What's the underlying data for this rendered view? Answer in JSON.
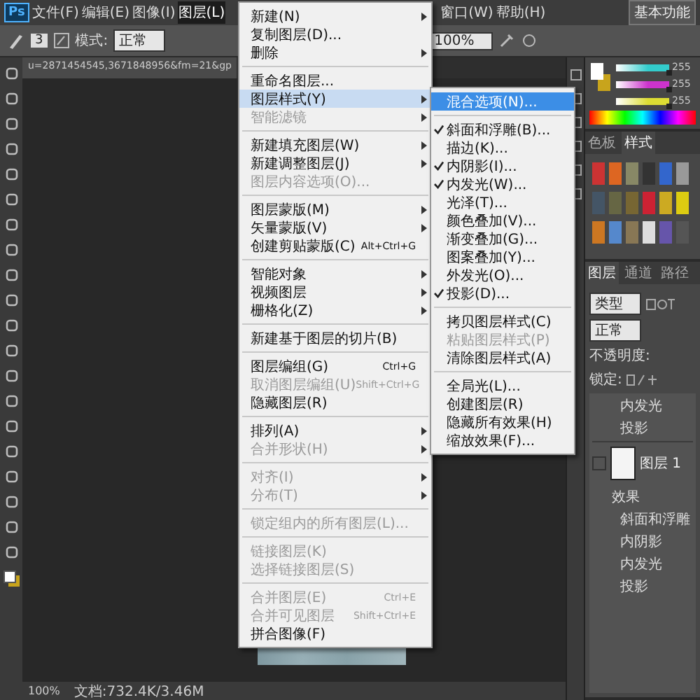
{
  "menu_bar": {
    "logo": "Ps",
    "items": [
      {
        "label": "文件(F)",
        "selected": false
      },
      {
        "label": "编辑(E)",
        "selected": false
      },
      {
        "label": "图像(I)",
        "selected": false
      },
      {
        "label": "图层(L)",
        "selected": true
      },
      {
        "label": "窗口(W)",
        "selected": false
      },
      {
        "label": "帮助(H)",
        "selected": false
      }
    ],
    "workspace": "基本功能"
  },
  "options_bar": {
    "brush_size": "3",
    "mode_label": "模式:",
    "mode": "正常",
    "flow": "100%"
  },
  "document_tab": {
    "title": "u=2871454545,3671848956&fm=21&gp"
  },
  "status_bar": {
    "zoom": "100%",
    "doc_info": "文档:732.4K/3.46M"
  },
  "layer_menu": {
    "groups": [
      [
        {
          "label": "新建(N)",
          "submenu": true,
          "disabled": false,
          "selected": false
        },
        {
          "label": "复制图层(D)...",
          "submenu": false,
          "disabled": false,
          "selected": false
        },
        {
          "label": "删除",
          "submenu": true,
          "disabled": false,
          "selected": false
        }
      ],
      [
        {
          "label": "重命名图层...",
          "submenu": false,
          "disabled": false,
          "selected": false
        },
        {
          "label": "图层样式(Y)",
          "submenu": true,
          "disabled": false,
          "selected": true
        },
        {
          "label": "智能滤镜",
          "submenu": true,
          "disabled": true,
          "selected": false
        }
      ],
      [
        {
          "label": "新建填充图层(W)",
          "submenu": true,
          "disabled": false,
          "selected": false
        },
        {
          "label": "新建调整图层(J)",
          "submenu": true,
          "disabled": false,
          "selected": false
        },
        {
          "label": "图层内容选项(O)...",
          "submenu": false,
          "disabled": true,
          "selected": false
        }
      ],
      [
        {
          "label": "图层蒙版(M)",
          "submenu": true,
          "disabled": false,
          "selected": false
        },
        {
          "label": "矢量蒙版(V)",
          "submenu": true,
          "disabled": false,
          "selected": false
        },
        {
          "label": "创建剪贴蒙版(C)",
          "shortcut": "Alt+Ctrl+G",
          "submenu": false,
          "disabled": false,
          "selected": false
        }
      ],
      [
        {
          "label": "智能对象",
          "submenu": true,
          "disabled": false,
          "selected": false
        },
        {
          "label": "视频图层",
          "submenu": true,
          "disabled": false,
          "selected": false
        },
        {
          "label": "栅格化(Z)",
          "submenu": true,
          "disabled": false,
          "selected": false
        }
      ],
      [
        {
          "label": "新建基于图层的切片(B)",
          "submenu": false,
          "disabled": false,
          "selected": false
        }
      ],
      [
        {
          "label": "图层编组(G)",
          "shortcut": "Ctrl+G",
          "submenu": false,
          "disabled": false,
          "selected": false
        },
        {
          "label": "取消图层编组(U)",
          "shortcut": "Shift+Ctrl+G",
          "submenu": false,
          "disabled": true,
          "selected": false
        },
        {
          "label": "隐藏图层(R)",
          "submenu": false,
          "disabled": false,
          "selected": false
        }
      ],
      [
        {
          "label": "排列(A)",
          "submenu": true,
          "disabled": false,
          "selected": false
        },
        {
          "label": "合并形状(H)",
          "submenu": true,
          "disabled": true,
          "selected": false
        }
      ],
      [
        {
          "label": "对齐(I)",
          "submenu": true,
          "disabled": true,
          "selected": false
        },
        {
          "label": "分布(T)",
          "submenu": true,
          "disabled": true,
          "selected": false
        }
      ],
      [
        {
          "label": "锁定组内的所有图层(L)...",
          "submenu": false,
          "disabled": true,
          "selected": false
        }
      ],
      [
        {
          "label": "链接图层(K)",
          "submenu": false,
          "disabled": true,
          "selected": false
        },
        {
          "label": "选择链接图层(S)",
          "submenu": false,
          "disabled": true,
          "selected": false
        }
      ],
      [
        {
          "label": "合并图层(E)",
          "shortcut": "Ctrl+E",
          "submenu": false,
          "disabled": true,
          "selected": false
        },
        {
          "label": "合并可见图层",
          "shortcut": "Shift+Ctrl+E",
          "submenu": false,
          "disabled": true,
          "selected": false
        },
        {
          "label": "拼合图像(F)",
          "submenu": false,
          "disabled": false,
          "selected": false
        }
      ]
    ]
  },
  "style_submenu": {
    "groups": [
      [
        {
          "label": "混合选项(N)...",
          "checked": false,
          "disabled": false,
          "selected": true
        }
      ],
      [
        {
          "label": "斜面和浮雕(B)...",
          "checked": true,
          "disabled": false,
          "selected": false
        },
        {
          "label": "描边(K)...",
          "checked": false,
          "disabled": false,
          "selected": false
        },
        {
          "label": "内阴影(I)...",
          "checked": true,
          "disabled": false,
          "selected": false
        },
        {
          "label": "内发光(W)...",
          "checked": true,
          "disabled": false,
          "selected": false
        },
        {
          "label": "光泽(T)...",
          "checked": false,
          "disabled": false,
          "selected": false
        },
        {
          "label": "颜色叠加(V)...",
          "checked": false,
          "disabled": false,
          "selected": false
        },
        {
          "label": "渐变叠加(G)...",
          "checked": false,
          "disabled": false,
          "selected": false
        },
        {
          "label": "图案叠加(Y)...",
          "checked": false,
          "disabled": false,
          "selected": false
        },
        {
          "label": "外发光(O)...",
          "checked": false,
          "disabled": false,
          "selected": false
        },
        {
          "label": "投影(D)...",
          "checked": true,
          "disabled": false,
          "selected": false
        }
      ],
      [
        {
          "label": "拷贝图层样式(C)",
          "checked": false,
          "disabled": false,
          "selected": false
        },
        {
          "label": "粘贴图层样式(P)",
          "checked": false,
          "disabled": true,
          "selected": false
        },
        {
          "label": "清除图层样式(A)",
          "checked": false,
          "disabled": false,
          "selected": false
        }
      ],
      [
        {
          "label": "全局光(L)...",
          "checked": false,
          "disabled": false,
          "selected": false
        },
        {
          "label": "创建图层(R)",
          "checked": false,
          "disabled": false,
          "selected": false
        },
        {
          "label": "隐藏所有效果(H)",
          "checked": false,
          "disabled": false,
          "selected": false
        },
        {
          "label": "缩放效果(F)...",
          "checked": false,
          "disabled": false,
          "selected": false
        }
      ]
    ]
  },
  "color_panel": {
    "sliders": [
      {
        "color": "#33cccc",
        "level": 1,
        "reading": "255"
      },
      {
        "color": "#cc33cc",
        "level": 1,
        "reading": "255"
      },
      {
        "color": "#dddd33",
        "level": 1,
        "reading": "255"
      }
    ]
  },
  "styles_panel": {
    "tabs": [
      {
        "label": "色板",
        "selected": false
      },
      {
        "label": "样式",
        "selected": true
      }
    ]
  },
  "layers_panel": {
    "tabs": [
      {
        "label": "图层",
        "selected": true
      },
      {
        "label": "通道",
        "selected": false
      },
      {
        "label": "路径",
        "selected": false
      }
    ],
    "filter": "类型",
    "blend_mode": "正常",
    "opacity_label": "不透明度:",
    "lock_label": "锁定:",
    "effects_above": [
      "内发光",
      "投影"
    ],
    "layers": [
      {
        "name": "图层 1",
        "effects_label": "效果",
        "effects": [
          "斜面和浮雕",
          "内阴影",
          "内发光",
          "投影"
        ]
      }
    ]
  }
}
